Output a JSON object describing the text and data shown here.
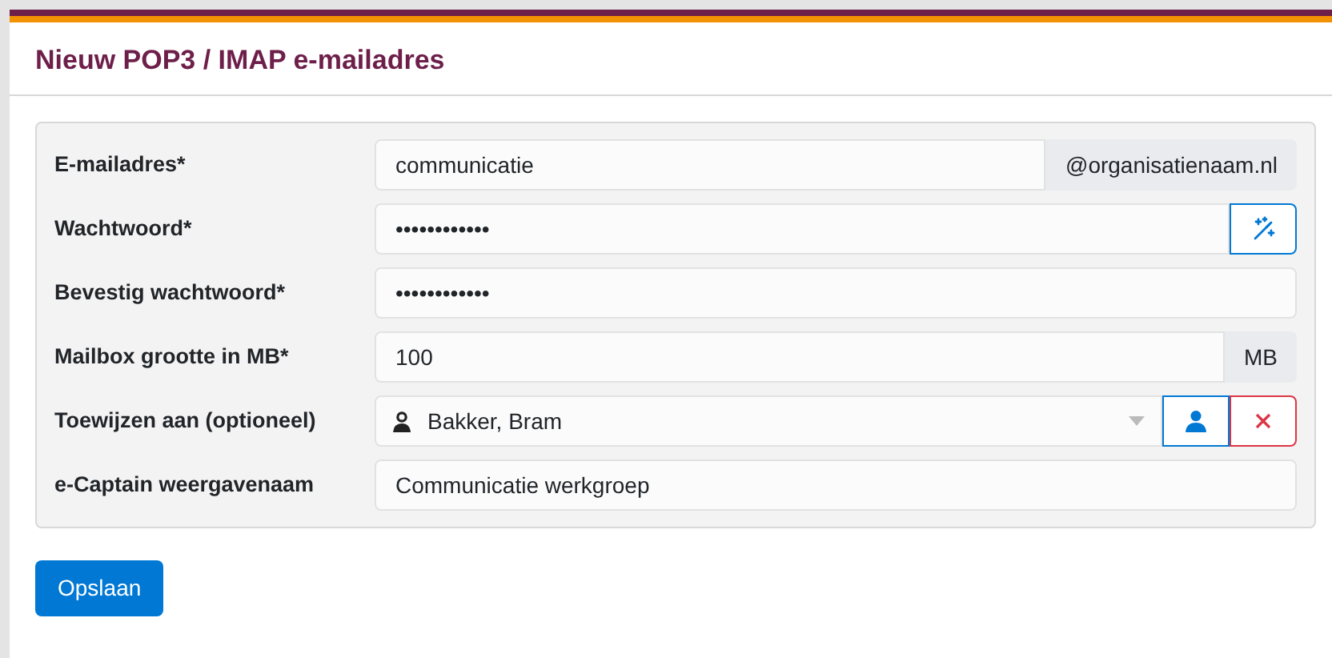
{
  "title": "Nieuw POP3 / IMAP e-mailadres",
  "fields": [
    {
      "kind": "addon",
      "label": "E-mailadres*",
      "value": "communicatie",
      "addon": "@organisatienaam.nl"
    },
    {
      "kind": "generate",
      "label": "Wachtwoord*",
      "value": "••••••••••••"
    },
    {
      "kind": "text",
      "label": "Bevestig wachtwoord*",
      "value": "••••••••••••"
    },
    {
      "kind": "addon",
      "label": "Mailbox grootte in MB*",
      "value": "100",
      "addon": "MB"
    },
    {
      "kind": "user",
      "label": "Toewijzen aan (optioneel)",
      "value": "Bakker, Bram"
    },
    {
      "kind": "text",
      "label": "e-Captain weergavenaam",
      "value": "Communicatie werkgroep"
    }
  ],
  "save_button": "Opslaan"
}
